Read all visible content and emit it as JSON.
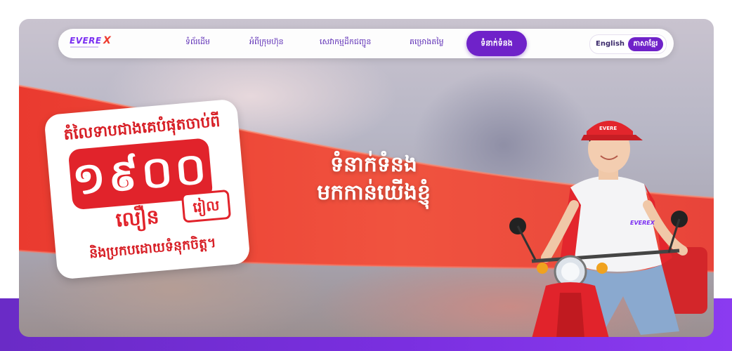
{
  "brand": {
    "logo_text": "EVERE",
    "logo_x": "X"
  },
  "nav": {
    "items": [
      {
        "label": "ទំព័រដើម"
      },
      {
        "label": "អំពីក្រុមហ៊ុន"
      },
      {
        "label": "សេវាកម្មដឹកជញ្ជូន"
      },
      {
        "label": "គម្រោងតម្លៃ"
      }
    ],
    "active_item": {
      "label": "ទំនាក់ទំនង"
    }
  },
  "language": {
    "english": "English",
    "khmer": "ភាសាខ្មែរ",
    "selected": "ភាសាខ្មែរ"
  },
  "promo": {
    "line1": "តំលៃទាបជាងគេបំផុតចាប់ពី",
    "price": "១៩០០",
    "unit": "រៀល",
    "fast": "លឿន",
    "line3": "និងប្រកបដោយទំនុកចិត្ត។"
  },
  "hero": {
    "title_line1": "ទំនាក់ទំនង",
    "title_line2": "មកកាន់យើងខ្ញុំ"
  },
  "colors": {
    "brand_purple": "#6f22c9",
    "brand_red": "#e1232b",
    "band_purple": "#7a2fe0"
  },
  "icons": {
    "courier": "courier-on-scooter-illustration"
  }
}
